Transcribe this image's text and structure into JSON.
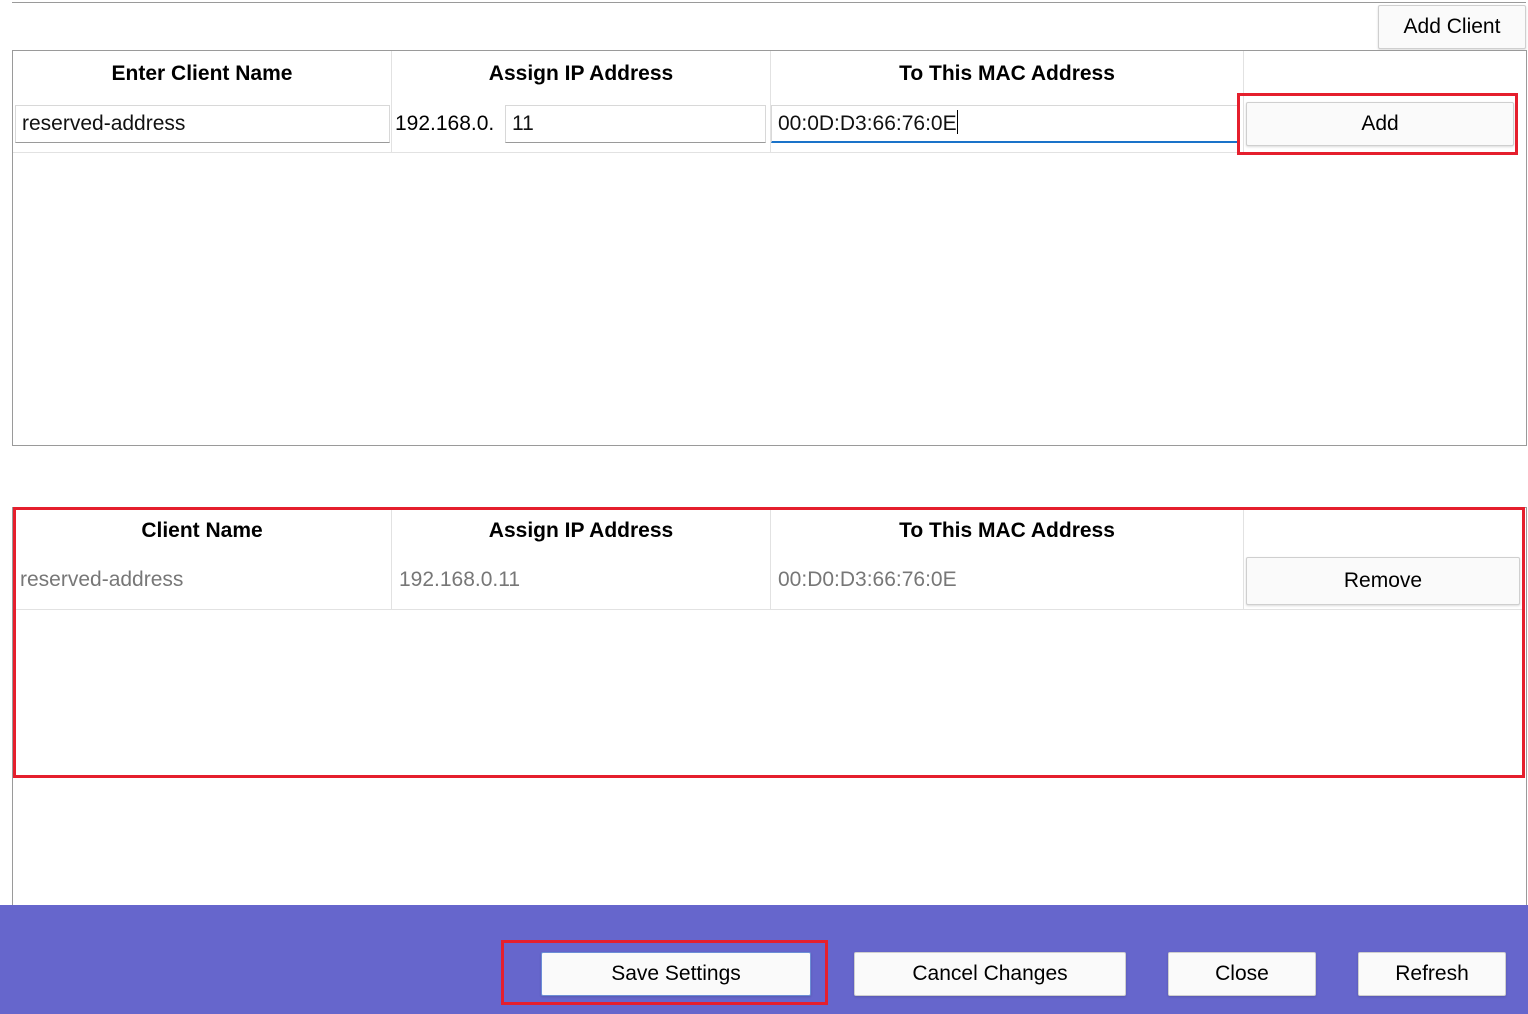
{
  "toolbar": {
    "add_client_label": "Add Client"
  },
  "entry_form": {
    "headers": [
      "Enter Client Name",
      "Assign IP Address",
      "To This MAC Address"
    ],
    "client_name_value": "reserved-address",
    "ip_prefix": "192.168.0.",
    "ip_suffix_value": "11",
    "mac_value": "00:0D:D3:66:76:0E",
    "add_label": "Add"
  },
  "reserved_table": {
    "headers": [
      "Client Name",
      "Assign IP Address",
      "To This MAC Address"
    ],
    "rows": [
      {
        "name": "reserved-address",
        "ip": "192.168.0.11",
        "mac": "00:D0:D3:66:76:0E",
        "remove_label": "Remove"
      }
    ]
  },
  "footer": {
    "save_label": "Save Settings",
    "cancel_label": "Cancel Changes",
    "close_label": "Close",
    "refresh_label": "Refresh"
  },
  "colors": {
    "highlight": "#e51f2d",
    "footer_bg": "#6666cc",
    "focus_underline": "#1a73c9"
  }
}
